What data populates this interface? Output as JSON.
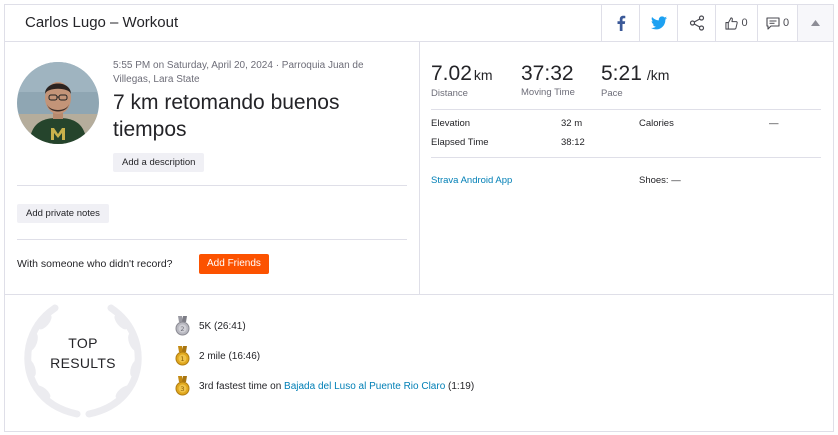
{
  "header": {
    "title": "Carlos Lugo – Workout",
    "kudos_count": "0",
    "comments_count": "0"
  },
  "activity": {
    "meta": "5:55 PM on Saturday, April 20, 2024 · Parroquia Juan de Villegas, Lara State",
    "title": "7 km retomando buenos tiempos",
    "add_description": "Add a description",
    "add_private_notes": "Add private notes",
    "friends_question": "With someone who didn't record?",
    "add_friends": "Add Friends"
  },
  "stats": {
    "distance": {
      "value": "7.02",
      "unit": "km",
      "label": "Distance"
    },
    "moving_time": {
      "value": "37:32",
      "label": "Moving Time"
    },
    "pace": {
      "value": "5:21",
      "unit": "/km",
      "label": "Pace"
    }
  },
  "more_stats": {
    "elevation_label": "Elevation",
    "elevation_value": "32 m",
    "elapsed_label": "Elapsed Time",
    "elapsed_value": "38:12",
    "calories_label": "Calories",
    "calories_value": "—",
    "device": "Strava Android App",
    "shoes_label": "Shoes:",
    "shoes_value": "—"
  },
  "top_results": {
    "heading_line1": "TOP",
    "heading_line2": "RESULTS",
    "items": [
      {
        "text": "5K (26:41)",
        "medal": "silver-medal-icon"
      },
      {
        "text": "2 mile (16:46)",
        "medal": "gold-medal-icon"
      },
      {
        "prefix": "3rd fastest time on ",
        "segment": "Bajada del Luso al Puente Rio Claro",
        "suffix": " (1:19)",
        "medal": "gold-medal-icon"
      }
    ]
  },
  "colors": {
    "accent": "#fc5200",
    "link": "#007fb6",
    "facebook": "#3b5998",
    "twitter": "#1da1f2"
  }
}
